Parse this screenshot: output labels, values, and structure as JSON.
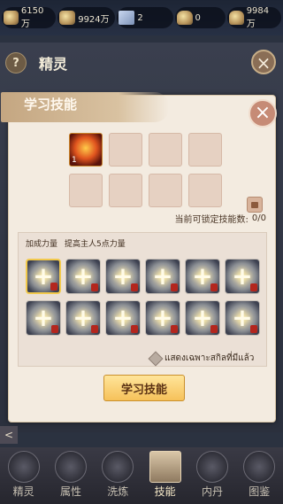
{
  "resources": [
    {
      "icon": "silver-coin-icon",
      "value": "6150万"
    },
    {
      "icon": "gold-coin-icon",
      "value": "9924万"
    },
    {
      "icon": "crystal-icon",
      "value": "2"
    },
    {
      "icon": "ingot-icon",
      "value": "0"
    },
    {
      "icon": "gold-ingot-icon",
      "value": "9984万"
    }
  ],
  "background_panel": {
    "help_label": "?",
    "title": "精灵",
    "close_label": "×"
  },
  "modal": {
    "title": "学习技能",
    "close_label": "×",
    "learn_slots": [
      {
        "filled": true,
        "count": "1"
      },
      {
        "filled": false
      },
      {
        "filled": false
      },
      {
        "filled": false
      },
      {
        "filled": false
      },
      {
        "filled": false
      },
      {
        "filled": false
      },
      {
        "filled": false
      }
    ],
    "lock_text": "当前可锁定技能数:",
    "lock_value": "0/0",
    "desc_name": "加成力量",
    "desc_text": "提高主人5点力量",
    "skill_count": 12,
    "filter_label": "แสดงเฉพาะสกิลที่มีแล้ว",
    "learn_button": "学习技能"
  },
  "side_arrow": "<",
  "nav": [
    {
      "label": "精灵",
      "icon": "spirit-icon"
    },
    {
      "label": "属性",
      "icon": "attribute-icon"
    },
    {
      "label": "洗炼",
      "icon": "refine-icon"
    },
    {
      "label": "技能",
      "icon": "skill-icon",
      "active": true
    },
    {
      "label": "内丹",
      "icon": "core-icon"
    },
    {
      "label": "图鉴",
      "icon": "codex-icon"
    }
  ]
}
